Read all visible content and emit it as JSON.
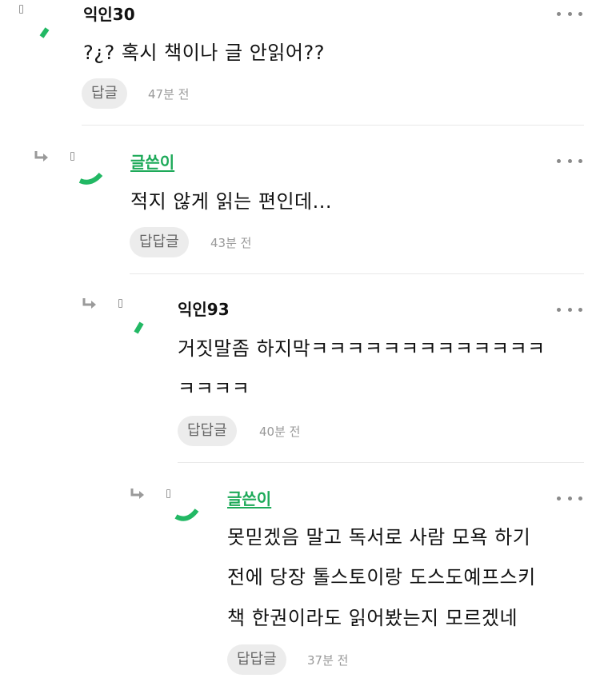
{
  "comments": [
    {
      "author": "익인30",
      "text": "?¿? 혹시 책이나 글 안읽어??",
      "reply_label": "답글",
      "time": "47분 전"
    },
    {
      "author": "글쓴이",
      "text": "적지 않게 읽는 편인데...",
      "reply_label": "답답글",
      "time": "43분 전"
    },
    {
      "author": "익인93",
      "text_line1": "거짓말좀 하지막ㅋㅋㅋㅋㅋㅋㅋㅋㅋㅋㅋㅋㅋ",
      "text_line2": "ㅋㅋㅋㅋ",
      "reply_label": "답답글",
      "time": "40분 전"
    },
    {
      "author": "글쓴이",
      "text_line1": "못믿겠음 말고 독서로 사람 모욕 하기",
      "text_line2": "전에 당장 톨스토이랑 도스도예프스키",
      "text_line3": "책 한권이라도 읽어봤는지 모르겠네",
      "reply_label": "답답글",
      "time": "37분 전"
    }
  ],
  "colors": {
    "op_author": "#1eaa5a",
    "avatar_stroke": "#22b864",
    "button_bg": "#ececec",
    "meta_text": "#999999"
  },
  "icons": {
    "reply_arrow": "reply-arrow-icon",
    "more": "more-dots-icon",
    "avatar": "avatar-icon"
  }
}
